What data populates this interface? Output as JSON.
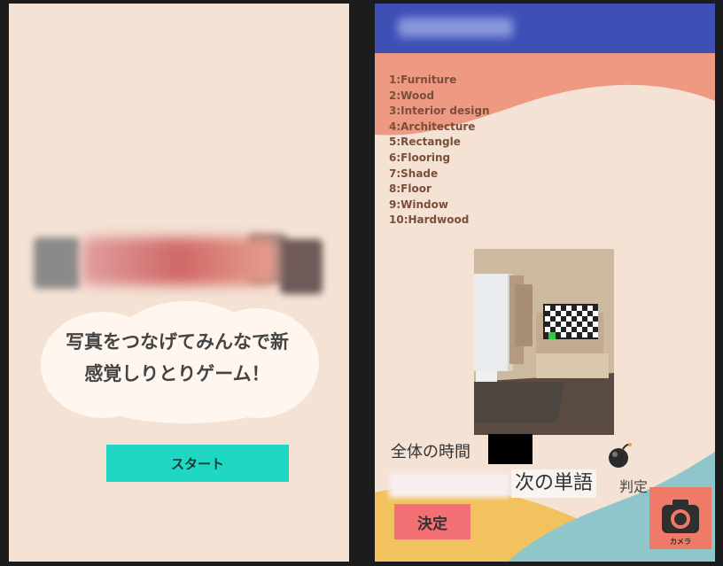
{
  "left_screen": {
    "tagline_line1": "写真をつなげてみんなで新",
    "tagline_line2": "感覚しりとりゲーム！",
    "start_button": "スタート"
  },
  "right_screen": {
    "colors": {
      "app_bar": "#3e50b6",
      "salmon": "#ee9a82",
      "teal": "#8fc6cb",
      "yellow": "#f2c25e"
    },
    "word_list": [
      "1:Furniture",
      "2:Wood",
      "3:Interior design",
      "4:Architecture",
      "5:Rectangle",
      "6:Flooring",
      "7:Shade",
      "8:Floor",
      "9:Window",
      "10:Hardwood"
    ],
    "total_time_label": "全体の時間",
    "next_word_label": "次の単語",
    "judge_label": "判定",
    "decide_button": "決定",
    "camera_label": "カメラ"
  }
}
